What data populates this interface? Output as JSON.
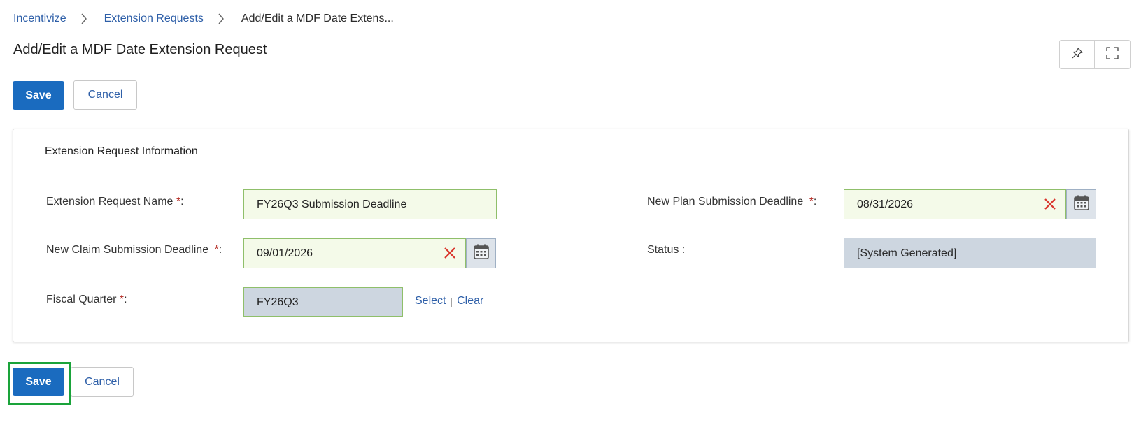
{
  "breadcrumb": {
    "items": [
      "Incentivize",
      "Extension Requests"
    ],
    "current": "Add/Edit a MDF Date Extens..."
  },
  "page": {
    "title": "Add/Edit a MDF Date Extension Request"
  },
  "toolbar": {
    "top_save_label": "Save",
    "top_cancel_label": "Cancel",
    "bottom_save_label": "Save",
    "bottom_cancel_label": "Cancel",
    "icons": [
      "pin-icon",
      "fullscreen-icon"
    ]
  },
  "section": {
    "title": "Extension Request Information",
    "fields": {
      "name": {
        "label": "Extension Request Name",
        "required_mark": "*",
        "colon": ":",
        "value": "FY26Q3 Submission Deadline"
      },
      "plan_deadline": {
        "label": "New Plan Submission Deadline",
        "required_mark": "*",
        "colon": ":",
        "value": "08/31/2026"
      },
      "claim_deadline": {
        "label": "New Claim Submission Deadline",
        "required_mark": "*",
        "colon": ":",
        "value": "09/01/2026"
      },
      "status": {
        "label": "Status :",
        "value": "[System Generated]"
      },
      "fiscal_quarter": {
        "label": "Fiscal Quarter",
        "required_mark": "*",
        "colon": ":",
        "value": "FY26Q3",
        "select_label": "Select",
        "separator": "|",
        "clear_label": "Clear"
      }
    }
  },
  "colors": {
    "primary": "#1a6bbf",
    "link": "#2e5fa8",
    "required": "#b3261e",
    "editable_bg": "#f4fae9",
    "readonly_bg": "#cdd6e0",
    "highlight": "#1aa33a"
  }
}
